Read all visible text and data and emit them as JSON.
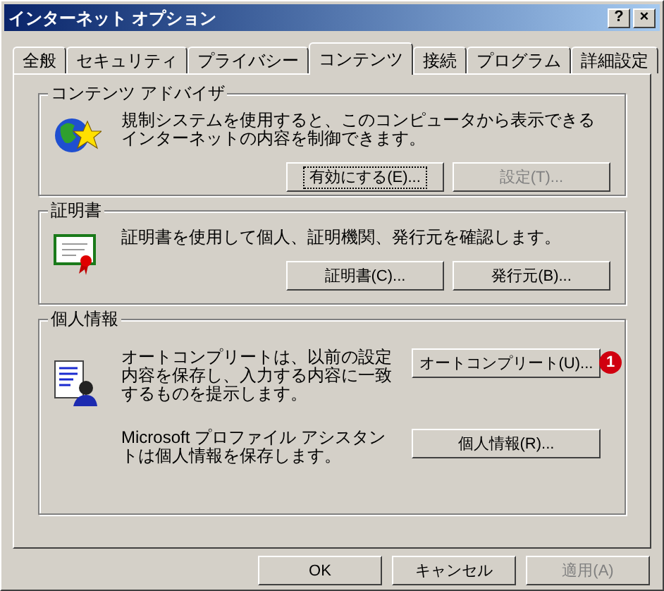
{
  "window": {
    "title": "インターネット オプション",
    "controls": [
      "?",
      "×"
    ]
  },
  "tabs": [
    {
      "label": "全般",
      "selected": false
    },
    {
      "label": "セキュリティ",
      "selected": false
    },
    {
      "label": "プライバシー",
      "selected": false
    },
    {
      "label": "コンテンツ",
      "selected": true
    },
    {
      "label": "接続",
      "selected": false
    },
    {
      "label": "プログラム",
      "selected": false
    },
    {
      "label": "詳細設定",
      "selected": false
    }
  ],
  "groups": [
    {
      "title": "コンテンツ アドバイザ",
      "rows": [
        {
          "kind": "stacked",
          "text": "規制システムを使用すると、このコンピュータから表示できるインターネットの内容を制御できます。",
          "buttons": [
            {
              "label": "有効にする(E)...",
              "disabled": false,
              "focused": true
            },
            {
              "label": "設定(T)...",
              "disabled": true,
              "focused": false
            }
          ]
        }
      ]
    },
    {
      "title": "証明書",
      "rows": [
        {
          "kind": "stacked",
          "text": "証明書を使用して個人、証明機関、発行元を確認します。",
          "buttons": [
            {
              "label": "証明書(C)...",
              "disabled": false,
              "focused": false
            },
            {
              "label": "発行元(B)...",
              "disabled": false,
              "focused": false
            }
          ]
        }
      ]
    },
    {
      "title": "個人情報",
      "rows": [
        {
          "kind": "inline",
          "text": "オートコンプリートは、以前の設定内容を保存し、入力する内容に一致するものを提示します。",
          "buttons": [
            {
              "label": "オートコンプリート(U)...",
              "disabled": false,
              "focused": false,
              "badge": "1"
            }
          ]
        },
        {
          "kind": "inline",
          "text": "Microsoft プロファイル アシスタントは個人情報を保存します。",
          "buttons": [
            {
              "label": "個人情報(R)...",
              "disabled": false,
              "focused": false
            }
          ]
        }
      ]
    }
  ],
  "buttons": [
    {
      "label": "OK",
      "disabled": false
    },
    {
      "label": "キャンセル",
      "disabled": false
    },
    {
      "label": "適用(A)",
      "disabled": true
    }
  ]
}
